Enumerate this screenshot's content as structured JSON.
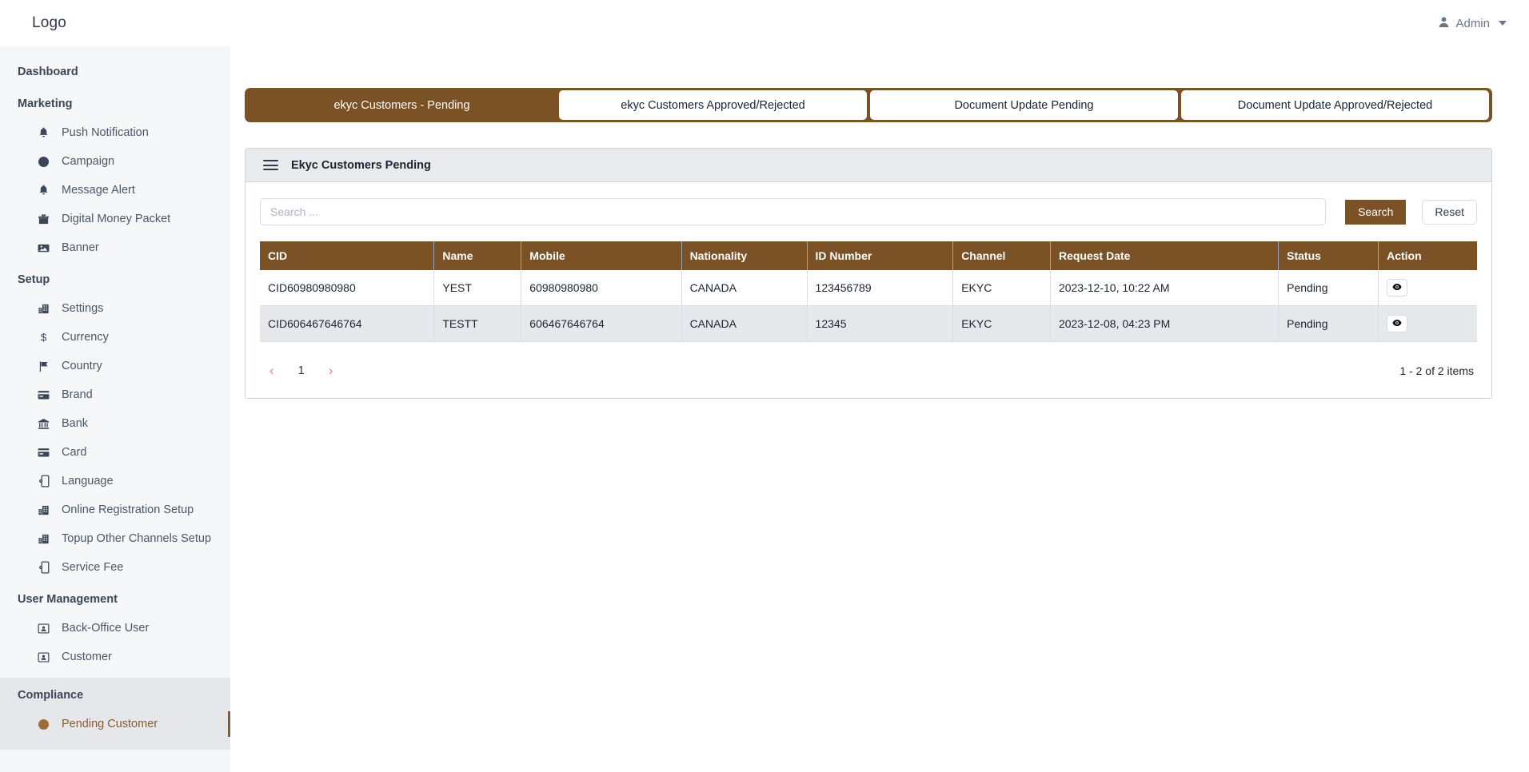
{
  "topbar": {
    "logo": "Logo",
    "user": "Admin",
    "user_icon": "person-icon",
    "caret_icon": "chevron-down-icon"
  },
  "sidebar": {
    "groups": [
      {
        "title": "Dashboard",
        "items": []
      },
      {
        "title": "Marketing",
        "items": [
          {
            "label": "Push Notification",
            "icon": "bell-icon"
          },
          {
            "label": "Campaign",
            "icon": "circle-icon"
          },
          {
            "label": "Message Alert",
            "icon": "bell-icon"
          },
          {
            "label": "Digital Money Packet",
            "icon": "gift-icon"
          },
          {
            "label": "Banner",
            "icon": "image-icon"
          }
        ]
      },
      {
        "title": "Setup",
        "items": [
          {
            "label": "Settings",
            "icon": "building-icon"
          },
          {
            "label": "Currency",
            "icon": "dollar-icon"
          },
          {
            "label": "Country",
            "icon": "flag-icon"
          },
          {
            "label": "Brand",
            "icon": "card-icon"
          },
          {
            "label": "Bank",
            "icon": "bank-icon"
          },
          {
            "label": "Card",
            "icon": "card-icon"
          },
          {
            "label": "Language",
            "icon": "device-gear-icon"
          },
          {
            "label": "Online Registration Setup",
            "icon": "building-icon"
          },
          {
            "label": "Topup Other Channels Setup",
            "icon": "building-icon"
          },
          {
            "label": "Service Fee",
            "icon": "device-gear-icon"
          }
        ]
      },
      {
        "title": "User Management",
        "items": [
          {
            "label": "Back-Office User",
            "icon": "id-card-icon"
          },
          {
            "label": "Customer",
            "icon": "id-card-icon"
          }
        ]
      },
      {
        "title": "Compliance",
        "items": [
          {
            "label": "Pending Customer",
            "icon": "circle-icon",
            "active": true
          }
        ]
      }
    ]
  },
  "tabs": [
    {
      "label": "ekyc Customers - Pending",
      "active": true
    },
    {
      "label": "ekyc Customers Approved/Rejected",
      "active": false
    },
    {
      "label": "Document Update Pending",
      "active": false
    },
    {
      "label": "Document Update Approved/Rejected",
      "active": false
    }
  ],
  "card": {
    "menu_icon": "hamburger-icon",
    "title": "Ekyc Customers Pending"
  },
  "search": {
    "placeholder": "Search ...",
    "value": "",
    "search_label": "Search",
    "reset_label": "Reset"
  },
  "table": {
    "columns": [
      "CID",
      "Name",
      "Mobile",
      "Nationality",
      "ID Number",
      "Channel",
      "Request Date",
      "Status",
      "Action"
    ],
    "rows": [
      {
        "cid": "CID60980980980",
        "name": "YEST",
        "mobile": "60980980980",
        "nationality": "CANADA",
        "id_number": "123456789",
        "channel": "EKYC",
        "request_date": "2023-12-10, 10:22 AM",
        "status": "Pending",
        "action_icon": "eye-icon"
      },
      {
        "cid": "CID606467646764",
        "name": "TESTT",
        "mobile": "606467646764",
        "nationality": "CANADA",
        "id_number": "12345",
        "channel": "EKYC",
        "request_date": "2023-12-08, 04:23 PM",
        "status": "Pending",
        "action_icon": "eye-icon"
      }
    ]
  },
  "pagination": {
    "prev_icon": "chevron-left-icon",
    "next_icon": "chevron-right-icon",
    "pages": [
      "1"
    ],
    "count_text": "1 - 2 of 2 items"
  },
  "colors": {
    "brand_brown": "#7a5226",
    "active_accent": "#8a5a2b",
    "sidebar_bg": "#f5f7f9",
    "pager_arrow": "#f08080"
  }
}
